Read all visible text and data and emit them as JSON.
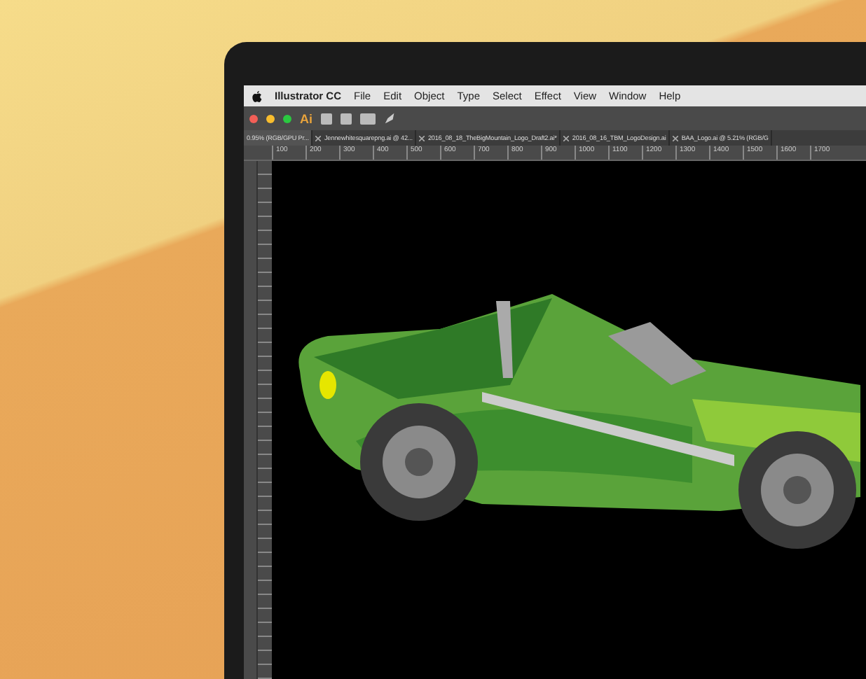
{
  "menu_bar": {
    "app_name": "Illustrator CC",
    "items": [
      "File",
      "Edit",
      "Object",
      "Type",
      "Select",
      "Effect",
      "View",
      "Window",
      "Help"
    ]
  },
  "toolbar": {
    "logo": "Ai"
  },
  "tabs": [
    {
      "label": "0.95% (RGB/GPU Pr...",
      "selected": true
    },
    {
      "label": "Jennewhitesquarepng.ai @ 42...",
      "selected": false
    },
    {
      "label": "2016_08_18_TheBigMountain_Logo_Draft2.ai*",
      "selected": false
    },
    {
      "label": "2016_08_16_TBM_LogoDesign.ai",
      "selected": false
    },
    {
      "label": "BAA_Logo.ai @ 5.21% (RGB/G",
      "selected": false
    }
  ],
  "ruler": [
    "100",
    "200",
    "300",
    "400",
    "500",
    "600",
    "700",
    "800",
    "900",
    "1000",
    "1100",
    "1200",
    "1300",
    "1400",
    "1500",
    "1600",
    "1700"
  ]
}
